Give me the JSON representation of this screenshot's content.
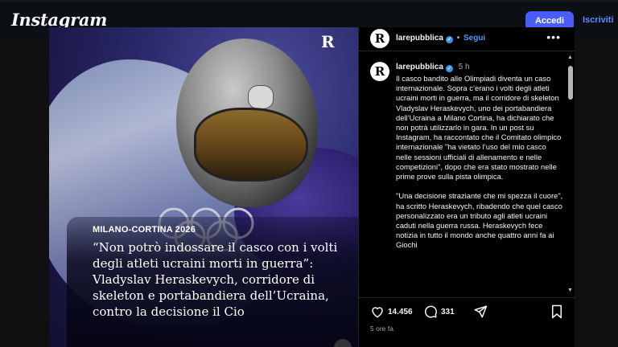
{
  "topbar": {
    "logo": "Instagram",
    "login_label": "Accedi",
    "signup_label": "Iscriviti",
    "accent": "#4a5df9"
  },
  "post": {
    "media": {
      "brand_mark": "R",
      "kicker": "MILANO-CORTINA 2026",
      "headline": "“Non potrò indossare il casco con i volti degli atleti ucraini morti in guerra”: Vladyslav Heraskevych, corridore di skeleton e portabandiera dell’Ucraina, contro la decisione il Cio"
    },
    "header": {
      "avatar_letter": "R",
      "username": "larepubblica",
      "separator": "•",
      "follow_label": "Segui",
      "more_icon": "more-horizontal-icon"
    },
    "caption": {
      "avatar_letter": "R",
      "username": "larepubblica",
      "time": "5 h",
      "text": "Il casco bandito alle Olimpiadi diventa un caso internazionale. Sopra c’erano i volti degli atleti ucraini morti in guerra, ma il corridore di skeleton Vladyslav Heraskevych, uno dei portabandiera dell’Ucraina a Milano Cortina, ha dichiarato che non potrà utilizzarlo in gara. In un post su Instagram, ha raccontato che il Comitato olimpico internazionale \"ha vietato l’uso del mio casco nelle sessioni ufficiali di allenamento e nelle competizioni\", dopo che era stato mostrato nelle prime prove sulla pista olimpica.\n\n\"Una decisione straziante che mi spezza il cuore\", ha scritto Heraskevych, ribadendo che quel casco personalizzato era un tributo agli atleti ucraini caduti nella guerra russa. Heraskevych fece notizia in tutto il mondo anche quattro anni fa ai Giochi"
    },
    "actions": {
      "like_icon": "heart-icon",
      "likes": "14.456",
      "comment_icon": "comment-icon",
      "comments": "331",
      "share_icon": "share-icon",
      "save_icon": "bookmark-icon",
      "posted_ago": "5 ore fa"
    }
  }
}
